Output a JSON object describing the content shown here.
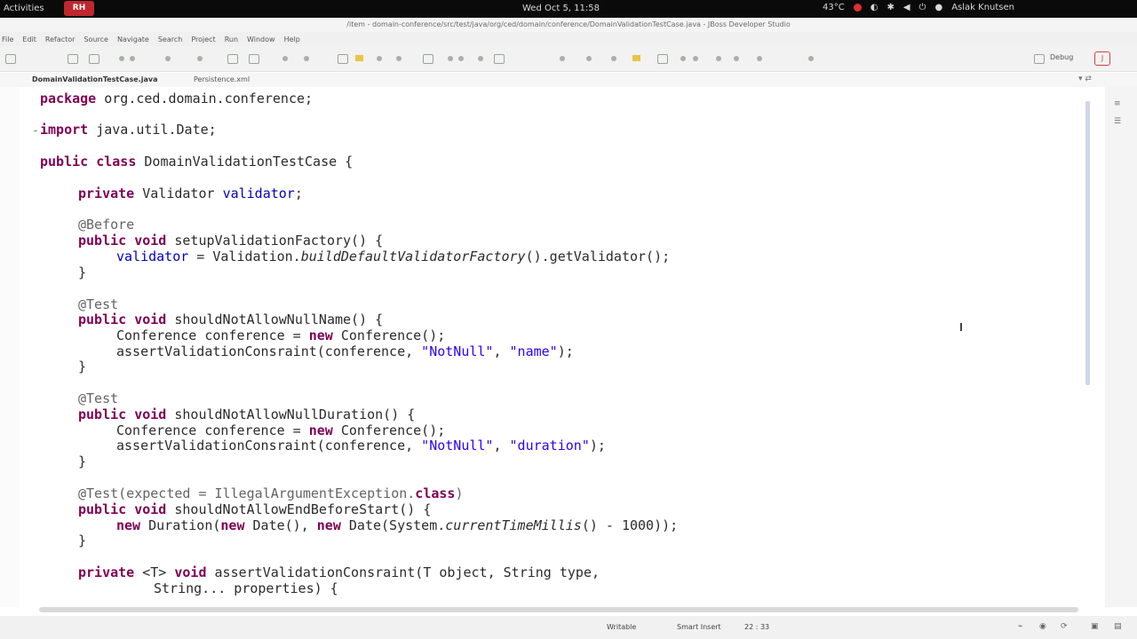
{
  "top_bar": {
    "activities": "Activities",
    "clock": "Wed Oct  5, 11:58",
    "temperature": "43°C",
    "user": "Aslak Knutsen"
  },
  "window": {
    "title": "/item - domain-conference/src/test/java/org/ced/domain/conference/DomainValidationTestCase.java - JBoss Developer Studio"
  },
  "menu": [
    "File",
    "Edit",
    "Refactor",
    "Source",
    "Navigate",
    "Search",
    "Project",
    "Run",
    "Window",
    "Help"
  ],
  "toolbar": {
    "perspective": "Debug"
  },
  "tabs": [
    {
      "label": "DomainValidationTestCase.java",
      "active": true
    },
    {
      "label": "Persistence.xml",
      "active": false
    }
  ],
  "code": [
    {
      "line": "package org.ced.domain.conference;"
    },
    {
      "line": "import java.util.Date;"
    },
    {
      "line": "public class DomainValidationTestCase {"
    },
    {
      "line": "private Validator validator;"
    },
    {
      "line": "@Before"
    },
    {
      "line": "public void setupValidationFactory() {"
    },
    {
      "line": "validator = Validation.buildDefaultValidatorFactory().getValidator();"
    },
    {
      "line": "}"
    },
    {
      "line": "@Test"
    },
    {
      "line": "public void shouldNotAllowNullName() {"
    },
    {
      "line": "Conference conference = new Conference();"
    },
    {
      "line": "assertValidationConsraint(conference, \"NotNull\", \"name\");"
    },
    {
      "line": "}"
    },
    {
      "line": "@Test"
    },
    {
      "line": "public void shouldNotAllowNullDuration() {"
    },
    {
      "line": "Conference conference = new Conference();"
    },
    {
      "line": "assertValidationConsraint(conference, \"NotNull\", \"duration\");"
    },
    {
      "line": "}"
    },
    {
      "line": "@Test(expected = IllegalArgumentException.class)"
    },
    {
      "line": "public void shouldNotAllowEndBeforeStart() {"
    },
    {
      "line": "new Duration(new Date(), new Date(System.currentTimeMillis() - 1000));"
    },
    {
      "line": "}"
    },
    {
      "line": "private <T> void assertValidationConsraint(T object, String type,"
    },
    {
      "line": "String... properties) {"
    }
  ],
  "status_bar": {
    "writable": "Writable",
    "insert_mode": "Smart Insert",
    "position": "22 : 33"
  }
}
